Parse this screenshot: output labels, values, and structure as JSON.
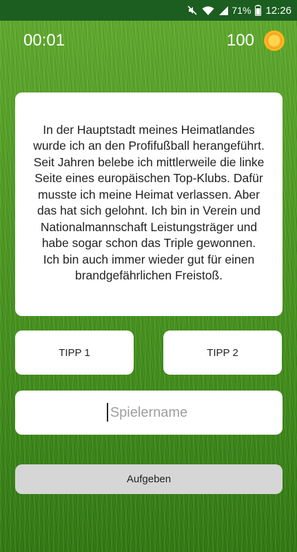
{
  "status_bar": {
    "battery_percent": "71%",
    "time": "12:26",
    "icons": [
      "mute-icon",
      "wifi-icon",
      "signal-icon",
      "battery-icon"
    ]
  },
  "game": {
    "timer": "00:01",
    "score": "100",
    "coin_icon": "coin-icon"
  },
  "clue": {
    "lines": [
      "In der Hauptstadt meines Heimatlandes",
      "wurde ich an den Profifußball herangeführt.",
      "Seit Jahren belebe ich mittlerweile die linke",
      "Seite eines europäischen Top-Klubs. Dafür",
      "musste ich meine Heimat verlassen. Aber",
      "das hat sich gelohnt. Ich bin in Verein und",
      "Nationalmannschaft Leistungsträger und",
      "habe sogar schon das Triple gewonnen.",
      "Ich bin auch immer wieder gut für einen",
      "brandgefährlichen Freistoß."
    ]
  },
  "tips": {
    "tip1_label": "TIPP 1",
    "tip2_label": "TIPP 2"
  },
  "answer": {
    "placeholder": "Spielername",
    "value": ""
  },
  "give_up_label": "Aufgeben",
  "colors": {
    "status_bar": "#1b5e20",
    "card": "#ffffff",
    "give_up": "#d6d6d6",
    "coin": "#f9a825"
  }
}
